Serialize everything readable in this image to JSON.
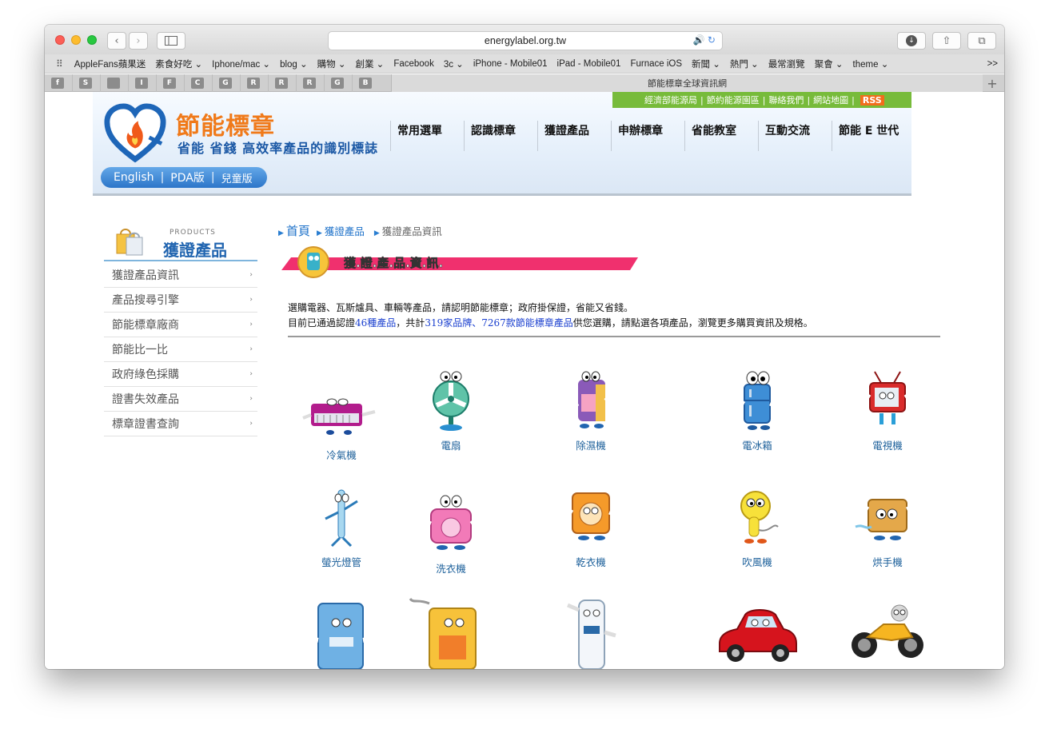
{
  "browser": {
    "url": "energylabel.org.tw",
    "tab_title": "節能標章全球資訊網",
    "bookmarks": [
      "AppleFans蘋果迷",
      "素食好吃 ⌄",
      "Iphone/mac ⌄",
      "blog ⌄",
      "購物 ⌄",
      "創業 ⌄",
      "Facebook",
      "3c ⌄",
      "iPhone - Mobile01",
      "iPad - Mobile01",
      "Furnace iOS",
      "新聞 ⌄",
      "熱門 ⌄",
      "最常瀏覽",
      "聚會 ⌄",
      "theme ⌄"
    ],
    "pinned_tabs": [
      "f",
      "S",
      "",
      "I",
      "F",
      "C",
      "G",
      "R",
      "R",
      "R",
      "G",
      "B"
    ]
  },
  "site": {
    "top_links": [
      "經濟部能源局",
      "節約能源園區",
      "聯絡我們",
      "網站地圖"
    ],
    "rss": "RSS",
    "logo_title": "節能標章",
    "logo_subtitle": "省能 省錢 高效率產品的識別標誌",
    "nav": [
      "常用選單",
      "認識標章",
      "獲證產品",
      "申辦標章",
      "省能教室",
      "互動交流",
      "節能 E 世代"
    ],
    "lang": [
      "English",
      "PDA版",
      "兒童版"
    ]
  },
  "sidebar": {
    "head_en": "PRODUCTS",
    "head_zh": "獲證產品",
    "items": [
      "獲證產品資訊",
      "產品搜尋引擎",
      "節能標章廠商",
      "節能比一比",
      "政府綠色採購",
      "證書失效產品",
      "標章證書查詢"
    ]
  },
  "breadcrumb": {
    "home": "首頁",
    "section": "獲證產品",
    "current": "獲證產品資訊"
  },
  "banner_title": "獲.證.產.品.資.訊.",
  "intro": {
    "line1": "選購電器、瓦斯爐具、車輛等產品，請認明節能標章；政府掛保證，省能又省錢。",
    "line2_pre": "目前已通過認證",
    "count_products": "46種產品",
    "line2_mid": "，共計",
    "count_brands": "319家品牌",
    "sep": "、",
    "count_models": "7267款節能標章產品",
    "line2_post": "供您選購，請點選各項產品，瀏覽更多購買資訊及規格。"
  },
  "products": [
    "冷氣機",
    "電扇",
    "除濕機",
    "電冰箱",
    "電視機",
    "螢光燈管",
    "洗衣機",
    "乾衣機",
    "吹風機",
    "烘手機"
  ]
}
